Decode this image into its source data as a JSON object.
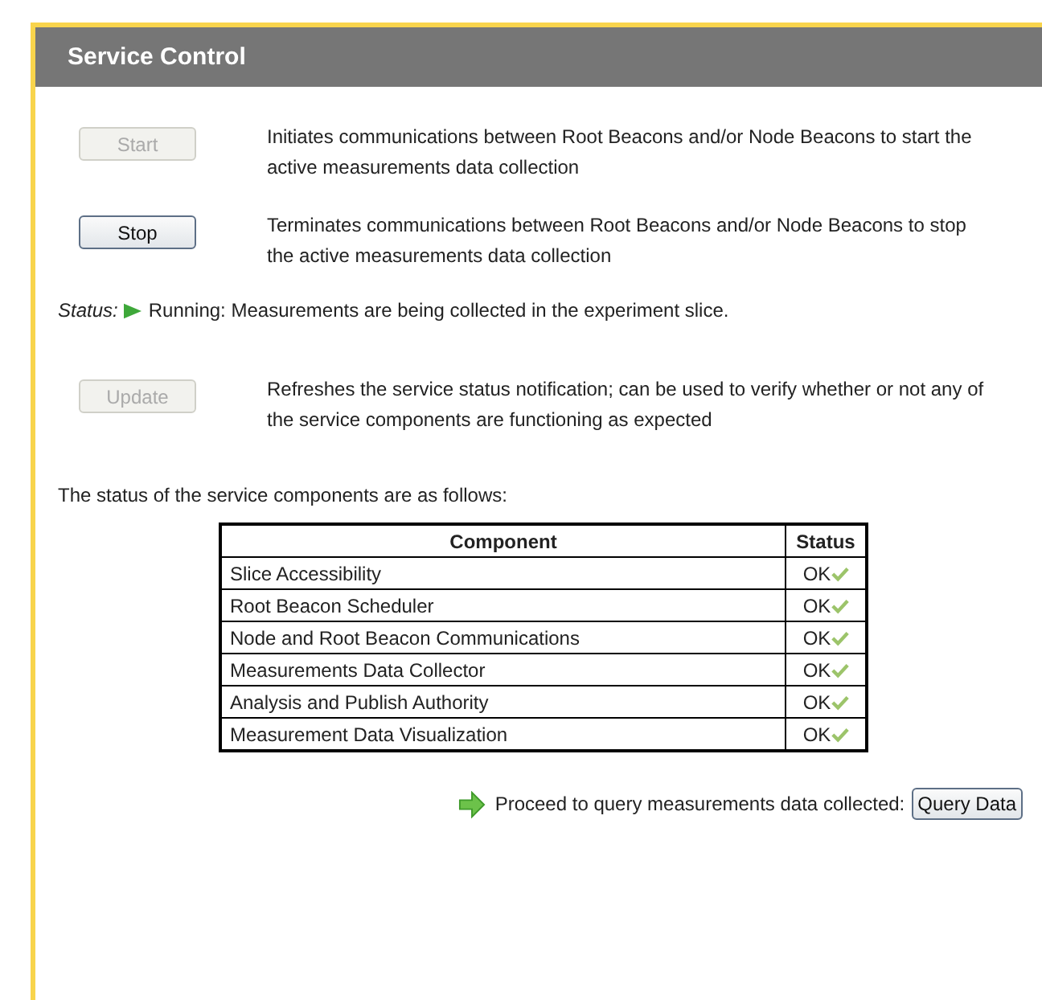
{
  "panel": {
    "title": "Service Control"
  },
  "actions": [
    {
      "label": "Start",
      "disabled": true,
      "description": "Initiates communications between Root Beacons and/or Node Beacons to start the active measurements data collection"
    },
    {
      "label": "Stop",
      "disabled": false,
      "description": "Terminates communications between Root Beacons and/or Node Beacons to stop the active measurements data collection"
    }
  ],
  "status": {
    "label": "Status:",
    "text": "Running: Measurements are being collected in the experiment slice."
  },
  "update": {
    "label": "Update",
    "disabled": true,
    "description": "Refreshes the service status notification; can be used to verify whether or not any of the service components are functioning as expected"
  },
  "components_intro": "The status of the service components are as follows:",
  "table": {
    "columns": [
      "Component",
      "Status"
    ],
    "rows": [
      {
        "component": "Slice Accessibility",
        "status": "OK"
      },
      {
        "component": "Root Beacon Scheduler",
        "status": "OK"
      },
      {
        "component": "Node and Root Beacon Communications",
        "status": "OK"
      },
      {
        "component": "Measurements Data Collector",
        "status": "OK"
      },
      {
        "component": "Analysis and Publish Authority",
        "status": "OK"
      },
      {
        "component": "Measurement Data Visualization",
        "status": "OK"
      }
    ]
  },
  "proceed": {
    "text": "Proceed to query measurements data collected:",
    "button": "Query Data"
  }
}
